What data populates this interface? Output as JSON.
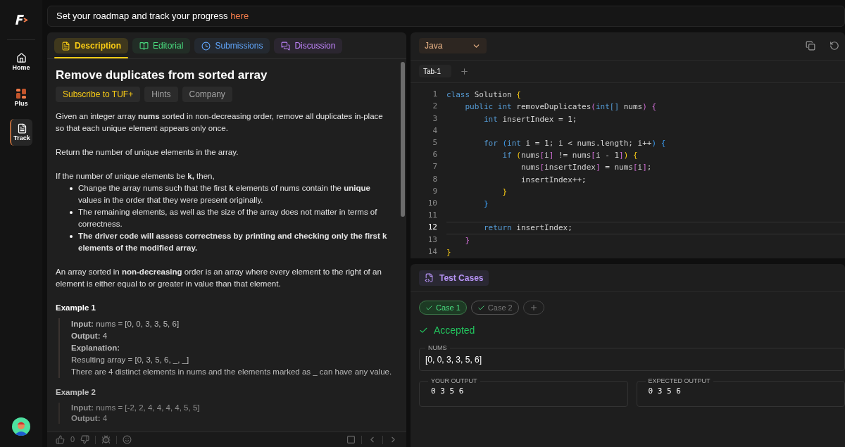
{
  "sidebar": {
    "items": [
      {
        "label": "Home",
        "selected": false
      },
      {
        "label": "Plus",
        "selected": false
      },
      {
        "label": "Track",
        "selected": true
      }
    ]
  },
  "banner": {
    "text": "Set your roadmap and track your progress ",
    "link": "here"
  },
  "problem_tabs": [
    {
      "label": "Description",
      "color": "#facc15",
      "selected": true
    },
    {
      "label": "Editorial",
      "color": "#4ade80",
      "selected": false
    },
    {
      "label": "Submissions",
      "color": "#60a5fa",
      "selected": false
    },
    {
      "label": "Discussion",
      "color": "#c084fc",
      "selected": false
    }
  ],
  "problem": {
    "title": "Remove duplicates from sorted array",
    "chips": [
      {
        "label": "Subscribe to TUF+",
        "kind": "premium"
      },
      {
        "label": "Hints",
        "kind": "plain"
      },
      {
        "label": "Company",
        "kind": "plain"
      }
    ],
    "blocks": [
      {
        "kind": "para",
        "text": "Given an integer array **nums** sorted in non-decreasing order, remove all duplicates in-place so that each unique element appears only once."
      },
      {
        "kind": "para",
        "text": "Return the number of unique elements in the array."
      },
      {
        "kind": "para",
        "text": "If the number of unique elements be **k,** then,"
      },
      {
        "kind": "bullets",
        "items": [
          "Change the array nums such that the first **k** elements of nums contain the **unique** values in the order that they were present originally.",
          "The remaining elements, as well as the size of the array does not matter in terms of correctness.",
          "**The driver code will assess correctness by printing and checking only the first k elements of the modified array.**"
        ]
      },
      {
        "kind": "para",
        "text": "An array sorted in **non-decreasing** order is an array where every element to the right of an element is either equal to or greater in value than that element."
      },
      {
        "kind": "example",
        "title": "Example 1",
        "faded": false,
        "lines": [
          "**Input:** nums = [0, 0, 3, 3, 5, 6]",
          "**Output:** 4",
          "**Explanation:**",
          "Resulting array = [0, 3, 5, 6, _, _]",
          "There are 4 distinct elements in nums and the elements marked as _ can have any value."
        ]
      },
      {
        "kind": "example",
        "title": "Example 2",
        "faded": true,
        "lines": [
          "**Input:** nums = [-2, 2, 4, 4, 4, 4, 5, 5]",
          "**Output:** 4"
        ]
      }
    ],
    "likes": "0"
  },
  "editor": {
    "language": "Java",
    "tabs": [
      {
        "label": "Tab-1",
        "selected": true
      }
    ],
    "lines": [
      {
        "number": "1",
        "current": false,
        "tokens": [
          {
            "t": "class ",
            "kind": "keyword"
          },
          {
            "t": "Solution ",
            "kind": "plain"
          },
          {
            "t": "{",
            "kind": "outer"
          }
        ]
      },
      {
        "number": "2",
        "current": false,
        "tokens": [
          {
            "t": "    public int ",
            "kind": "keyword"
          },
          {
            "t": "removeDuplicates",
            "kind": "plain"
          },
          {
            "t": "(",
            "kind": "middle"
          },
          {
            "t": "int[] ",
            "kind": "keyword"
          },
          {
            "t": "nums",
            "kind": "plain"
          },
          {
            "t": ") {",
            "kind": "middle"
          }
        ]
      },
      {
        "number": "3",
        "current": false,
        "tokens": [
          {
            "t": "        int ",
            "kind": "keyword"
          },
          {
            "t": "insertIndex = 1;",
            "kind": "plain"
          }
        ]
      },
      {
        "number": "4",
        "current": false
      },
      {
        "number": "5",
        "current": false,
        "tokens": [
          {
            "t": "        for ",
            "kind": "keyword"
          },
          {
            "t": "(",
            "kind": "inner"
          },
          {
            "t": "int ",
            "kind": "keyword"
          },
          {
            "t": "i = 1; i < nums.length; i++",
            "kind": "plain"
          },
          {
            "t": ") {",
            "kind": "inner"
          }
        ]
      },
      {
        "number": "6",
        "current": false,
        "tokens": [
          {
            "t": "            if ",
            "kind": "keyword"
          },
          {
            "t": "(",
            "kind": "outer"
          },
          {
            "t": "nums",
            "kind": "plain"
          },
          {
            "t": "[",
            "kind": "middle"
          },
          {
            "t": "i",
            "kind": "plain"
          },
          {
            "t": "]",
            "kind": "middle"
          },
          {
            "t": " != nums",
            "kind": "plain"
          },
          {
            "t": "[",
            "kind": "middle"
          },
          {
            "t": "i - 1",
            "kind": "plain"
          },
          {
            "t": "]",
            "kind": "middle"
          },
          {
            "t": ") {",
            "kind": "outer"
          }
        ]
      },
      {
        "number": "7",
        "current": false,
        "tokens": [
          {
            "t": "                nums",
            "kind": "plain"
          },
          {
            "t": "[",
            "kind": "middle"
          },
          {
            "t": "insertIndex",
            "kind": "plain"
          },
          {
            "t": "]",
            "kind": "middle"
          },
          {
            "t": " = nums",
            "kind": "plain"
          },
          {
            "t": "[",
            "kind": "middle"
          },
          {
            "t": "i",
            "kind": "plain"
          },
          {
            "t": "]",
            "kind": "middle"
          },
          {
            "t": ";",
            "kind": "plain"
          }
        ]
      },
      {
        "number": "8",
        "current": false,
        "tokens": [
          {
            "t": "                insertIndex++;",
            "kind": "plain"
          }
        ]
      },
      {
        "number": "9",
        "current": false,
        "tokens": [
          {
            "t": "            }",
            "kind": "outer"
          }
        ]
      },
      {
        "number": "10",
        "current": false,
        "tokens": [
          {
            "t": "        }",
            "kind": "inner"
          }
        ]
      },
      {
        "number": "11",
        "current": false
      },
      {
        "number": "12",
        "current": true,
        "tokens": [
          {
            "t": "        return ",
            "kind": "keyword"
          },
          {
            "t": "insertIndex;",
            "kind": "plain"
          }
        ]
      },
      {
        "number": "13",
        "current": false,
        "tokens": [
          {
            "t": "    }",
            "kind": "middle"
          }
        ]
      },
      {
        "number": "14",
        "current": false,
        "tokens": [
          {
            "t": "}",
            "kind": "outer"
          }
        ]
      }
    ]
  },
  "test_panel": {
    "title": "Test Cases",
    "cases": [
      {
        "label": "Case 1",
        "passed": true,
        "selected": true
      },
      {
        "label": "Case 2",
        "passed": true,
        "selected": false
      }
    ],
    "verdict": {
      "text": "Accepted",
      "passed": true
    },
    "input": {
      "label": "NUMS",
      "value": "[0, 0, 3, 3, 5, 6]"
    },
    "outputs": [
      {
        "label": "YOUR OUTPUT",
        "value": "0 3 5 6"
      },
      {
        "label": "EXPECTED OUTPUT",
        "value": "0 3 5 6"
      }
    ]
  }
}
